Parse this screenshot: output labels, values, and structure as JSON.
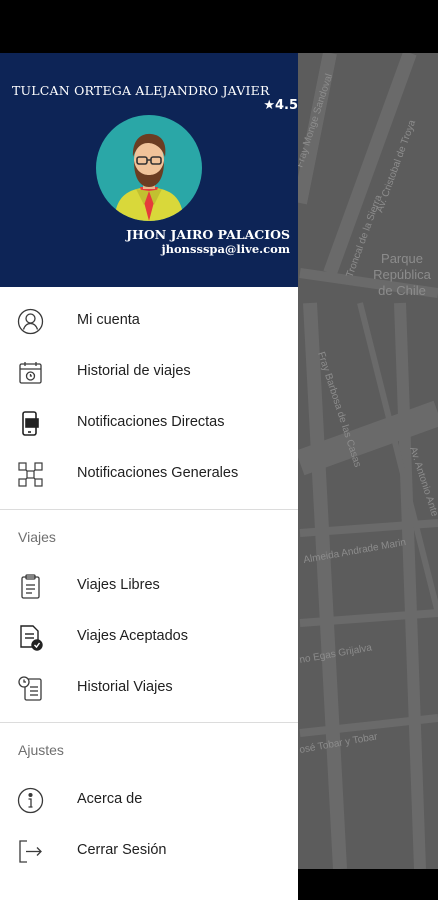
{
  "drawer": {
    "header": {
      "rider_name": "TULCAN ORTEGA ALEJANDRO JAVIER",
      "rating": "★4.5",
      "driver_name": "JHON JAIRO PALACIOS",
      "driver_email": "jhonssspa@live.com"
    },
    "main_items": [
      {
        "label": "Mi cuenta",
        "icon": "user-icon"
      },
      {
        "label": "Historial de viajes",
        "icon": "calendar-history-icon"
      },
      {
        "label": "Notificaciones Directas",
        "icon": "phone-notification-icon"
      },
      {
        "label": "Notificaciones Generales",
        "icon": "network-notification-icon"
      }
    ],
    "sections": [
      {
        "title": "Viajes",
        "items": [
          {
            "label": "Viajes Libres",
            "icon": "clipboard-icon"
          },
          {
            "label": "Viajes Aceptados",
            "icon": "document-check-icon"
          },
          {
            "label": "Historial Viajes",
            "icon": "clock-document-icon"
          }
        ]
      },
      {
        "title": "Ajustes",
        "items": [
          {
            "label": "Acerca de",
            "icon": "info-icon"
          },
          {
            "label": "Cerrar Sesión",
            "icon": "logout-icon"
          }
        ]
      }
    ]
  },
  "map": {
    "labels": {
      "monje_sandoval": "Fray Monge Sandoval",
      "cristobal_de_troya": "Av. Cristobal de Troya",
      "troncal": "Troncal de la Sierra",
      "parque_1": "Parque",
      "parque_2": "República",
      "parque_3": "de Chile",
      "barbosa": "Fray Barbosa de las Casas",
      "antonio_ante": "Av. Antonio Ante",
      "almeida": "Almeida Andrade Marin",
      "egas": "no Egas Grijalva",
      "tobar": "osé Tobar y Tobar"
    },
    "colors": {
      "background": "#5c5c5c",
      "road": "#6c6c6c",
      "text": "#8c8c8c"
    }
  },
  "colors": {
    "header": "#0d2456",
    "avatar": "#2aa7a7",
    "icon": "#3a3a3a"
  }
}
